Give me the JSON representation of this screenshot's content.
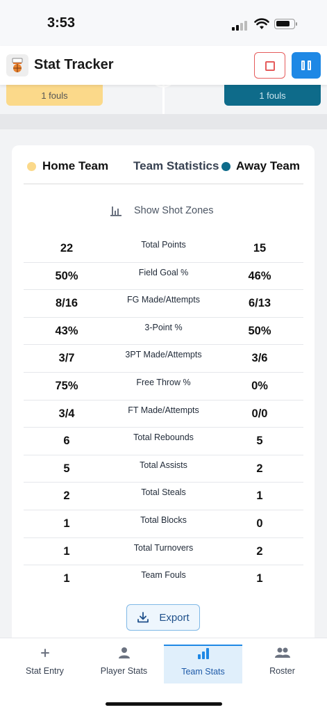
{
  "status": {
    "time": "3:53"
  },
  "header": {
    "title": "Stat Tracker",
    "logo_icon": "basketball-hoop-icon",
    "stop_icon": "stop-icon",
    "pause_icon": "pause-icon"
  },
  "court": {
    "home_fouls": "1 fouls",
    "away_fouls": "1 fouls"
  },
  "team_stats": {
    "home_label": "Home Team",
    "away_label": "Away Team",
    "title": "Team Statistics",
    "home_color": "#fbd98a",
    "away_color": "#0e6b8a",
    "shot_zones_label": "Show Shot Zones",
    "rows": [
      {
        "home": "22",
        "label": "Total Points",
        "away": "15"
      },
      {
        "home": "50%",
        "label": "Field Goal %",
        "away": "46%"
      },
      {
        "home": "8/16",
        "label": "FG Made/Attempts",
        "away": "6/13"
      },
      {
        "home": "43%",
        "label": "3-Point %",
        "away": "50%"
      },
      {
        "home": "3/7",
        "label": "3PT Made/Attempts",
        "away": "3/6"
      },
      {
        "home": "75%",
        "label": "Free Throw %",
        "away": "0%"
      },
      {
        "home": "3/4",
        "label": "FT Made/Attempts",
        "away": "0/0"
      },
      {
        "home": "6",
        "label": "Total Rebounds",
        "away": "5"
      },
      {
        "home": "5",
        "label": "Total Assists",
        "away": "2"
      },
      {
        "home": "2",
        "label": "Total Steals",
        "away": "1"
      },
      {
        "home": "1",
        "label": "Total Blocks",
        "away": "0"
      },
      {
        "home": "1",
        "label": "Total Turnovers",
        "away": "2"
      },
      {
        "home": "1",
        "label": "Team Fouls",
        "away": "1"
      }
    ],
    "export_label": "Export"
  },
  "tabs": [
    {
      "label": "Stat Entry",
      "icon": "plus-icon",
      "active": false
    },
    {
      "label": "Player Stats",
      "icon": "person-icon",
      "active": false
    },
    {
      "label": "Team Stats",
      "icon": "bar-chart-icon",
      "active": true
    },
    {
      "label": "Roster",
      "icon": "people-icon",
      "active": false
    }
  ]
}
